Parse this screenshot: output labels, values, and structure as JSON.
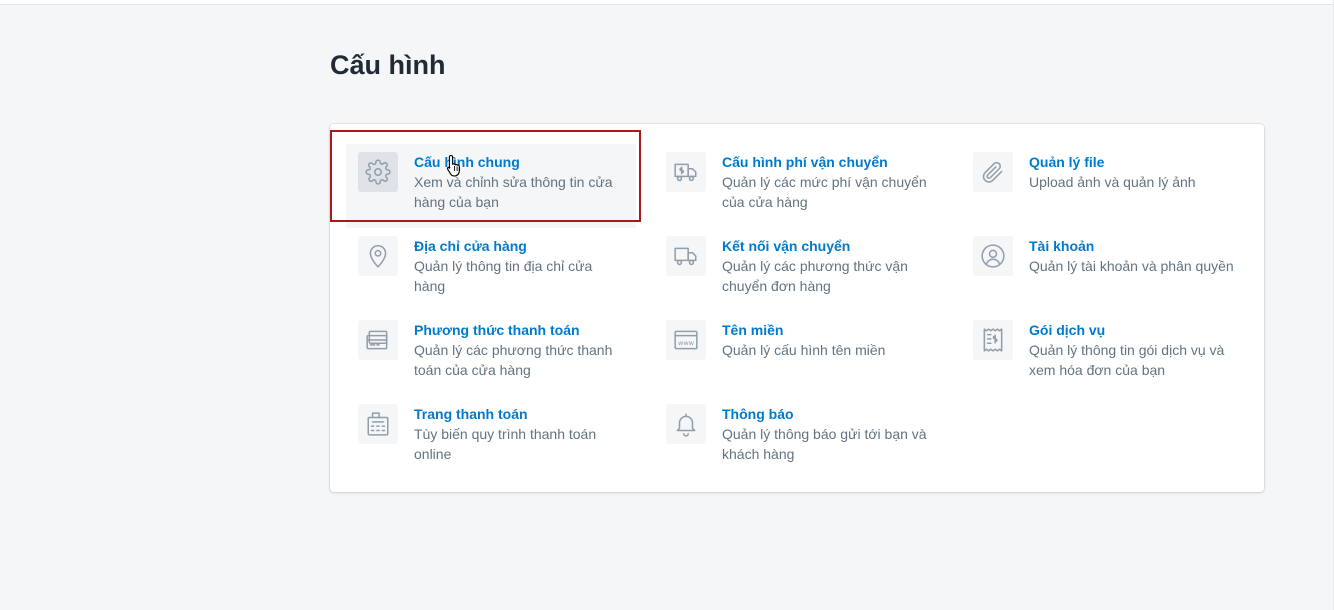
{
  "page": {
    "title": "Cấu hình"
  },
  "items": [
    {
      "title": "Cấu hình chung",
      "description": "Xem và chỉnh sửa thông tin cửa hàng của bạn",
      "icon": "gear-icon"
    },
    {
      "title": "Cấu hình phí vận chuyển",
      "description": "Quản lý các mức phí vận chuyển của cửa hàng",
      "icon": "shipping-fee-truck-icon"
    },
    {
      "title": "Quản lý file",
      "description": "Upload ảnh và quản lý ảnh",
      "icon": "paperclip-icon"
    },
    {
      "title": "Địa chỉ cửa hàng",
      "description": "Quản lý thông tin địa chỉ cửa hàng",
      "icon": "map-pin-icon"
    },
    {
      "title": "Kết nối vận chuyển",
      "description": "Quản lý các phương thức vận chuyển đơn hàng",
      "icon": "truck-icon"
    },
    {
      "title": "Tài khoản",
      "description": "Quản lý tài khoản và phân quyền",
      "icon": "user-circle-icon"
    },
    {
      "title": "Phương thức thanh toán",
      "description": "Quản lý các phương thức thanh toán của cửa hàng",
      "icon": "credit-card-icon"
    },
    {
      "title": "Tên miền",
      "description": "Quản lý cấu hình tên miền",
      "icon": "www-browser-icon"
    },
    {
      "title": "Gói dịch vụ",
      "description": "Quản lý thông tin gói dịch vụ và xem hóa đơn của bạn",
      "icon": "receipt-icon"
    },
    {
      "title": "Trang thanh toán",
      "description": "Tùy biến quy trình thanh toán online",
      "icon": "pos-terminal-icon"
    },
    {
      "title": "Thông báo",
      "description": "Quản lý thông báo gửi tới bạn và khách hàng",
      "icon": "bell-icon"
    }
  ],
  "colors": {
    "link": "#007ace",
    "text_muted": "#637381",
    "highlight_border": "#a81a1a"
  }
}
